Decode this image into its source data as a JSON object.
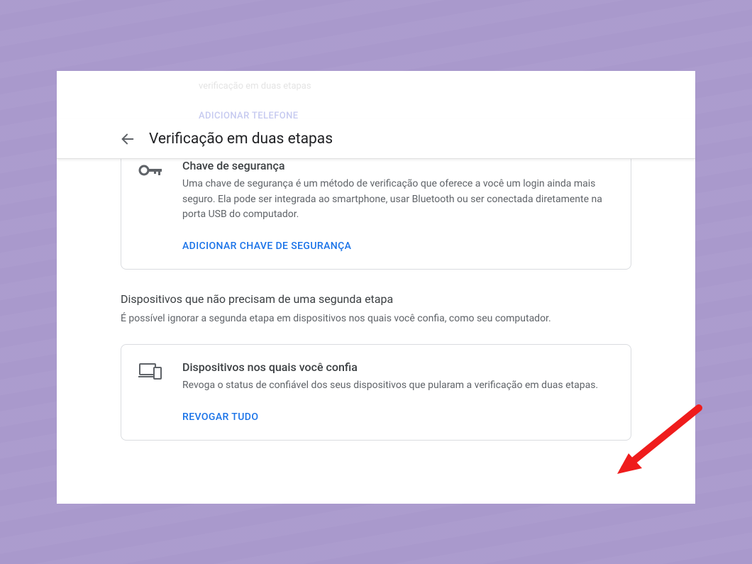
{
  "faded": {
    "line1": "verificação em duas etapas",
    "line2": "ADICIONAR TELEFONE"
  },
  "header": {
    "title": "Verificação em duas etapas"
  },
  "securityKeyCard": {
    "title": "Chave de segurança",
    "description": "Uma chave de segurança é um método de verificação que oferece a você um login ainda mais seguro. Ela pode ser integrada ao smartphone, usar Bluetooth ou ser conectada diretamente na porta USB do computador.",
    "action": "ADICIONAR CHAVE DE SEGURANÇA"
  },
  "trustedSection": {
    "heading": "Dispositivos que não precisam de uma segunda etapa",
    "subheading": "É possível ignorar a segunda etapa em dispositivos nos quais você confia, como seu computador."
  },
  "trustedCard": {
    "title": "Dispositivos nos quais você confia",
    "description": "Revoga o status de confiável dos seus dispositivos que pularam a verificação em duas etapas.",
    "action": "REVOGAR TUDO"
  }
}
